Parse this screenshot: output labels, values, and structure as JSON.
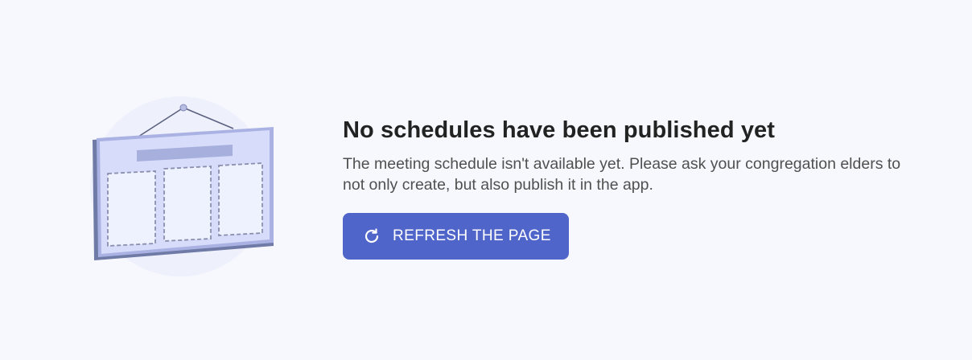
{
  "empty_state": {
    "title": "No schedules have been published yet",
    "description": "The meeting schedule isn't available yet. Please ask your congregation elders to not only create, but also publish it in the app.",
    "illustration_icon": "hanging-board-icon"
  },
  "actions": {
    "refresh_label": "REFRESH THE PAGE",
    "refresh_icon": "refresh-icon"
  },
  "colors": {
    "background": "#f7f8fd",
    "accent": "#5065ca",
    "title": "#222222",
    "body_text": "#505050"
  }
}
